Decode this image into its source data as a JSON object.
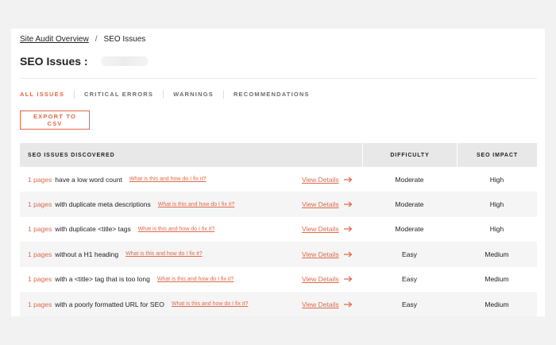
{
  "breadcrumb": {
    "parent": "Site Audit Overview",
    "separator": "/",
    "current": "SEO Issues"
  },
  "page": {
    "title": "SEO Issues :"
  },
  "tabs": [
    {
      "label": "ALL ISSUES",
      "active": true
    },
    {
      "label": "CRITICAL ERRORS",
      "active": false
    },
    {
      "label": "WARNINGS",
      "active": false
    },
    {
      "label": "RECOMMENDATIONS",
      "active": false
    }
  ],
  "export": {
    "label": "EXPORT TO CSV"
  },
  "table": {
    "headers": {
      "issues": "SEO ISSUES DISCOVERED",
      "difficulty": "DIFFICULTY",
      "impact": "SEO IMPACT"
    },
    "help_text": "What is this and how do I fix it?",
    "details_text": "View Details",
    "rows": [
      {
        "count": "1 pages",
        "description": "have a low word count",
        "difficulty": "Moderate",
        "impact": "High"
      },
      {
        "count": "1 pages",
        "description": "with duplicate meta descriptions",
        "difficulty": "Moderate",
        "impact": "High"
      },
      {
        "count": "1 pages",
        "description": "with duplicate <title> tags",
        "difficulty": "Moderate",
        "impact": "High"
      },
      {
        "count": "1 pages",
        "description": "without a H1 heading",
        "difficulty": "Easy",
        "impact": "Medium"
      },
      {
        "count": "1 pages",
        "description": "with a <title> tag that is too long",
        "difficulty": "Easy",
        "impact": "Medium"
      },
      {
        "count": "1 pages",
        "description": "with a poorly formatted URL for SEO",
        "difficulty": "Easy",
        "impact": "Medium"
      }
    ]
  },
  "colors": {
    "accent": "#e0694a",
    "header_bg": "#e8e8e8",
    "row_alt_bg": "#f5f5f5"
  },
  "icons": {
    "details_arrow": "arrow-right-icon"
  }
}
